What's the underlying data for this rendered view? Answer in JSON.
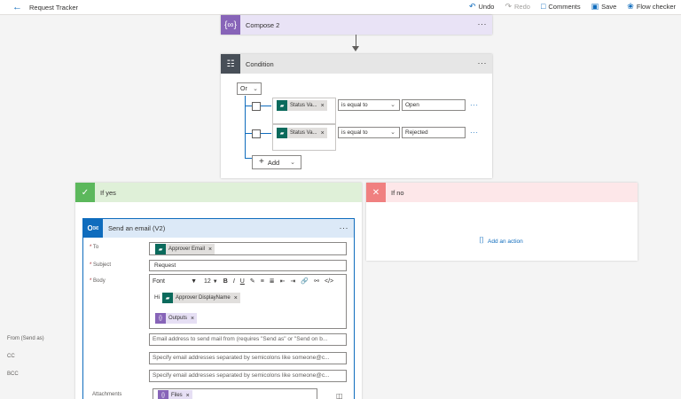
{
  "topbar": {
    "back_icon": "back-arrow-icon",
    "title": "Request Tracker",
    "actions": [
      {
        "label": "Undo",
        "icon": "undo-icon",
        "enabled": true
      },
      {
        "label": "Redo",
        "icon": "redo-icon",
        "enabled": false
      },
      {
        "label": "Comments",
        "icon": "comment-icon",
        "enabled": true
      },
      {
        "label": "Save",
        "icon": "save-icon",
        "enabled": true
      },
      {
        "label": "Flow checker",
        "icon": "stethoscope-icon",
        "enabled": true
      }
    ]
  },
  "compose": {
    "title": "Compose 2",
    "icon": "compose-icon",
    "color": "#8764b8",
    "header_color": "#e9e3f6",
    "more": "···"
  },
  "condition": {
    "title": "Condition",
    "icon": "condition-icon",
    "color": "#484f58",
    "header_color": "#e6e6e6",
    "more": "···",
    "group_operator": "Or",
    "rows": [
      {
        "token": "Status Va...",
        "operator": "is equal to",
        "value": "Open",
        "more": "···"
      },
      {
        "token": "Status Va...",
        "operator": "is equal to",
        "value": "Rejected",
        "more": "···"
      }
    ],
    "add_label": "Add"
  },
  "branches": {
    "yes": {
      "title": "If yes",
      "icon": "check-icon",
      "color": "#5cb85c",
      "header_color": "#dff0d8"
    },
    "no": {
      "title": "If no",
      "icon": "close-icon",
      "color": "#f08080",
      "header_color": "#fde7e9",
      "add_action_label": "Add an action"
    }
  },
  "email": {
    "title": "Send an email (V2)",
    "icon": "outlook-icon",
    "more": "···",
    "fields": {
      "to": {
        "label": "To",
        "token": "Approver Email"
      },
      "subject": {
        "label": "Subject",
        "value": "Request"
      },
      "body": {
        "label": "Body",
        "font": "Font",
        "size": "12",
        "greeting": "Hi",
        "token_name": "Approver DisplayName",
        "token_outputs": "Outputs"
      },
      "from": {
        "label": "From (Send as)",
        "placeholder": "Email address to send mail from (requires \"Send as\" or \"Send on b..."
      },
      "cc": {
        "label": "CC",
        "placeholder": "Specify email addresses separated by semicolons like someone@c..."
      },
      "bcc": {
        "label": "BCC",
        "placeholder": "Specify email addresses separated by semicolons like someone@c..."
      },
      "attachments": {
        "label": "Attachments",
        "token": "Files"
      }
    }
  }
}
